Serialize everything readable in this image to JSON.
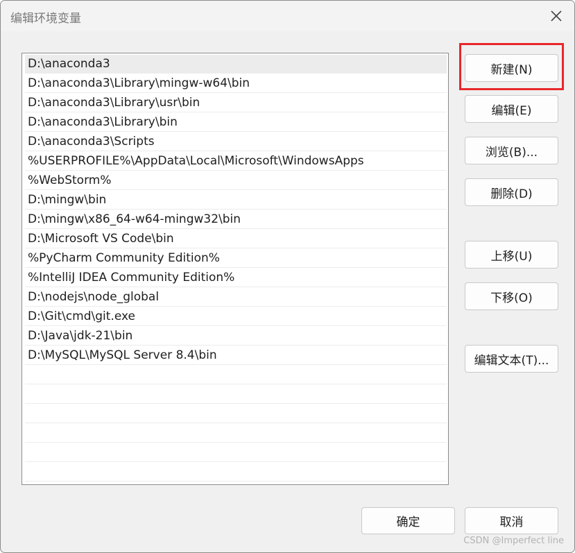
{
  "window": {
    "title": "编辑环境变量"
  },
  "list": {
    "items": [
      "D:\\anaconda3",
      "D:\\anaconda3\\Library\\mingw-w64\\bin",
      "D:\\anaconda3\\Library\\usr\\bin",
      "D:\\anaconda3\\Library\\bin",
      "D:\\anaconda3\\Scripts",
      "%USERPROFILE%\\AppData\\Local\\Microsoft\\WindowsApps",
      "%WebStorm%",
      "D:\\mingw\\bin",
      "D:\\mingw\\x86_64-w64-mingw32\\bin",
      "D:\\Microsoft VS Code\\bin",
      "%PyCharm Community Edition%",
      "%IntelliJ IDEA Community Edition%",
      "D:\\nodejs\\node_global",
      "D:\\Git\\cmd\\git.exe",
      "D:\\Java\\jdk-21\\bin",
      "D:\\MySQL\\MySQL Server 8.4\\bin",
      "",
      "",
      "",
      "",
      "",
      "",
      ""
    ],
    "selected_index": 0
  },
  "buttons": {
    "new": "新建(N)",
    "edit": "编辑(E)",
    "browse": "浏览(B)...",
    "delete": "删除(D)",
    "move_up": "上移(U)",
    "move_down": "下移(O)",
    "edit_text": "编辑文本(T)...",
    "ok": "确定",
    "cancel": "取消"
  },
  "watermark": "CSDN @Imperfect line",
  "colors": {
    "highlight": "#e8272c",
    "selection": "#ececec"
  },
  "icons": {
    "close": "close-icon"
  }
}
